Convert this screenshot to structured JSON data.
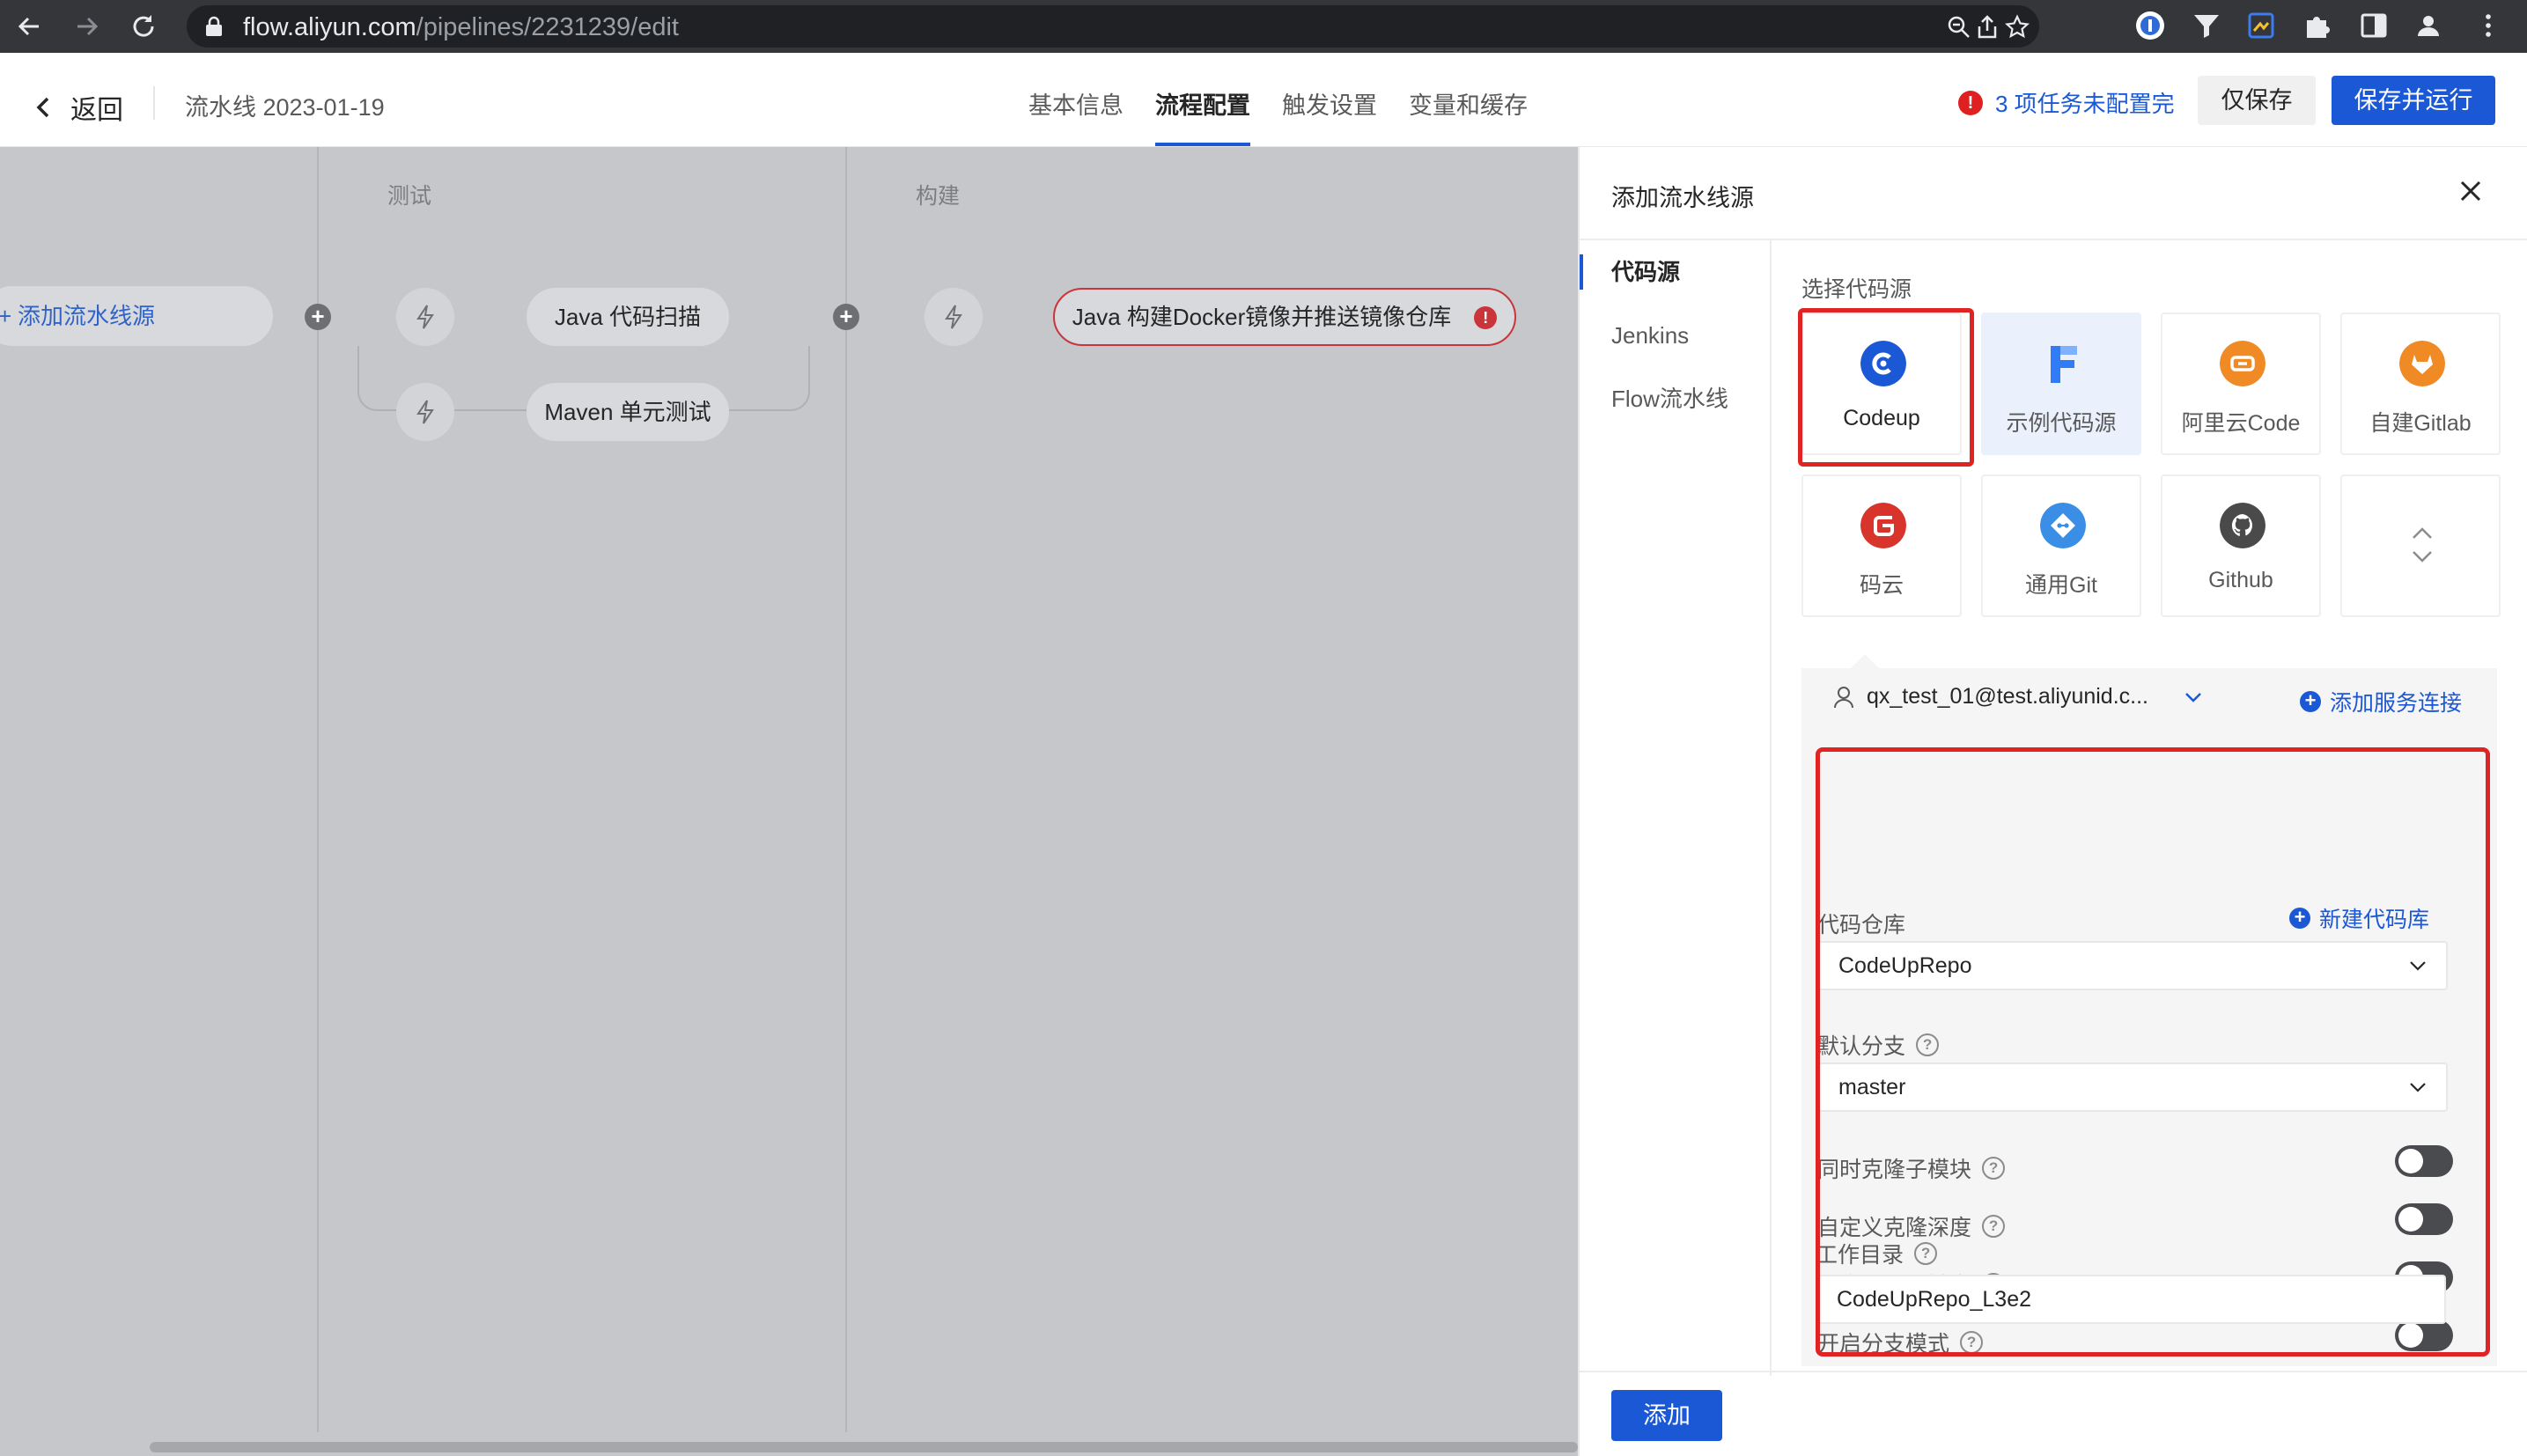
{
  "browser": {
    "url_host": "flow.aliyun.com",
    "url_path": "/pipelines/2231239/edit"
  },
  "header": {
    "back_label": "返回",
    "pipeline_title": "流水线 2023-01-19",
    "tabs": [
      {
        "label": "基本信息",
        "active": false
      },
      {
        "label": "流程配置",
        "active": true
      },
      {
        "label": "触发设置",
        "active": false
      },
      {
        "label": "变量和缓存",
        "active": false
      }
    ],
    "warning_text": "3 项任务未配置完",
    "save_only_label": "仅保存",
    "save_run_label": "保存并运行"
  },
  "canvas": {
    "stages": [
      "测试",
      "构建"
    ],
    "add_source_label": "添加流水线源",
    "jobs": [
      "Java 代码扫描",
      "Maven 单元测试",
      "Java 构建Docker镜像并推送镜像仓库"
    ]
  },
  "panel": {
    "title": "添加流水线源",
    "nav": [
      {
        "label": "代码源",
        "active": true
      },
      {
        "label": "Jenkins",
        "active": false
      },
      {
        "label": "Flow流水线",
        "active": false
      }
    ],
    "section_label": "选择代码源",
    "sources": [
      {
        "label": "Codeup",
        "icon": "codeup-icon",
        "color": "#1b58d6"
      },
      {
        "label": "示例代码源",
        "icon": "sample-code-f-icon",
        "color": "#2f7cf6"
      },
      {
        "label": "阿里云Code",
        "icon": "aliyun-code-icon",
        "color": "#f08a24"
      },
      {
        "label": "自建Gitlab",
        "icon": "gitlab-icon",
        "color": "#f08a24"
      },
      {
        "label": "码云",
        "icon": "gitee-icon",
        "color": "#d9342b"
      },
      {
        "label": "通用Git",
        "icon": "git-icon",
        "color": "#3a8ee6"
      },
      {
        "label": "Github",
        "icon": "github-icon",
        "color": "#4a4a4a"
      }
    ],
    "account": "qx_test_01@test.aliyunid.c...",
    "add_service_conn": "添加服务连接",
    "repo_label": "代码仓库",
    "new_repo": "新建代码库",
    "repo_value": "CodeUpRepo",
    "branch_label": "默认分支",
    "branch_value": "master",
    "toggles": [
      {
        "label": "同时克隆子模块",
        "on": false
      },
      {
        "label": "自定义克隆深度",
        "on": false
      },
      {
        "label": "开启代码源触发",
        "on": false
      },
      {
        "label": "开启分支模式",
        "on": false
      }
    ],
    "workdir_label": "工作目录",
    "workdir_value": "CodeUpRepo_L3e2",
    "add_button": "添加"
  },
  "colors": {
    "primary": "#1b58d6",
    "highlight": "#e02424",
    "canvas_bg": "#c6c7ca"
  }
}
